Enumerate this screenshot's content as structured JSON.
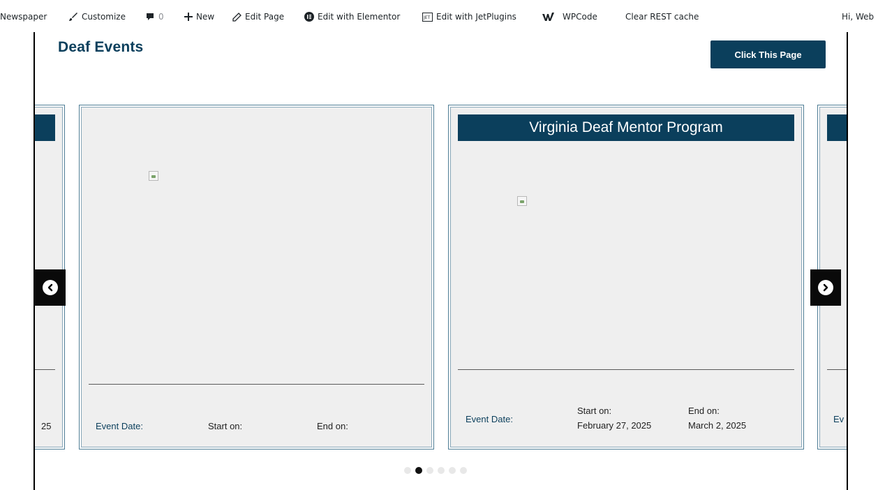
{
  "admin_bar": {
    "site_name": "Newspaper",
    "customize": "Customize",
    "comments_count": "0",
    "new": "New",
    "edit_page": "Edit Page",
    "edit_elementor": "Edit with Elementor",
    "edit_jetplugins": "Edit with JetPlugins",
    "wpcode": "WPCode",
    "clear_cache": "Clear REST cache",
    "greeting": "Hi, Web"
  },
  "section": {
    "title": "Deaf Events",
    "button_label": "Click This Page"
  },
  "carousel": {
    "prev_partial_text": "25",
    "next_partial_text": "Ev",
    "cards": [
      {
        "title": "",
        "event_date_label": "Event Date:",
        "start_label": "Start on:",
        "start_value": "",
        "end_label": "End on:",
        "end_value": ""
      },
      {
        "title": "Virginia Deaf Mentor Program",
        "event_date_label": "Event Date:",
        "start_label": "Start on:",
        "start_value": "February 27, 2025",
        "end_label": "End on:",
        "end_value": "March 2, 2025"
      }
    ],
    "dots_total": 6,
    "active_dot": 2
  },
  "colors": {
    "brand": "#0b3f5c",
    "card_bg": "#efefef"
  },
  "icons": [
    "brush-icon",
    "comment-icon",
    "plus-icon",
    "pencil-icon",
    "elementor-icon",
    "jetplugins-icon",
    "wpcode-icon",
    "chevron-left-icon",
    "chevron-right-icon"
  ]
}
